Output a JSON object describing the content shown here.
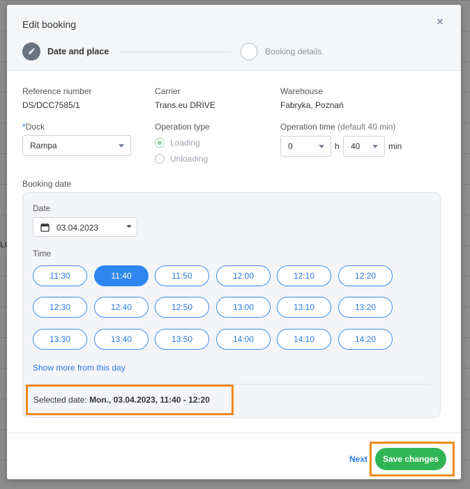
{
  "background": {
    "partial_text": "LC"
  },
  "modal": {
    "title": "Edit booking",
    "close_symbol": "×",
    "steps": [
      {
        "label": "Date and place",
        "active": true
      },
      {
        "label": "Booking details",
        "active": false
      }
    ]
  },
  "info": {
    "reference": {
      "label": "Reference number",
      "value": "DS/DCC7585/1"
    },
    "carrier": {
      "label": "Carrier",
      "value": "Trans.eu DRIVE"
    },
    "warehouse": {
      "label": "Warehouse",
      "value": "Fabryka, Poznań"
    }
  },
  "dock": {
    "required_mark": "*",
    "label": "Dock",
    "value": "Rampa"
  },
  "operation_type": {
    "label": "Operation type",
    "options": [
      {
        "label": "Loading",
        "checked": true
      },
      {
        "label": "Unloading",
        "checked": false
      }
    ]
  },
  "operation_time": {
    "label": "Operation time",
    "hint": "(default 40 min)",
    "hours_value": "0",
    "hours_unit": "h",
    "minutes_value": "40",
    "minutes_unit": "min"
  },
  "booking_date": {
    "label": "Booking date",
    "date_label": "Date",
    "date_value": "03.04.2023",
    "date_arrows": "◂▸",
    "time_label": "Time",
    "slots": [
      [
        "11:30",
        "11:40",
        "11:50",
        "12:00",
        "12:10",
        "12:20"
      ],
      [
        "12:30",
        "12:40",
        "12:50",
        "13:00",
        "13:10",
        "13:20"
      ],
      [
        "13:30",
        "13:40",
        "13:50",
        "14:00",
        "14:10",
        "14:20"
      ]
    ],
    "selected_slot": "11:40",
    "show_more": "Show more from this day",
    "selected_prefix": "Selected date: ",
    "selected_value": "Mon., 03.04.2023, 11:40 - 12:20"
  },
  "footer": {
    "next_label": "Next",
    "save_label": "Save changes"
  },
  "colors": {
    "accent_blue": "#2f86ee",
    "save_green": "#2fb556",
    "highlight_orange": "#f18a1c"
  }
}
